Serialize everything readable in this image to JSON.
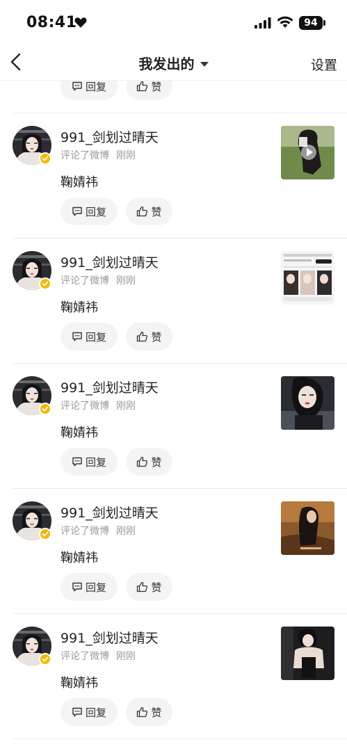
{
  "status_bar": {
    "time": "08:41",
    "battery": "94"
  },
  "nav": {
    "title": "我发出的",
    "settings": "设置"
  },
  "items": [
    {
      "username": "991_剑划过晴天",
      "action": "评论了微博",
      "time": "刚刚",
      "comment": "鞠婧祎",
      "reply_label": "回复",
      "like_label": "赞",
      "thumb_icon": "collage-thumbnail"
    },
    {
      "username": "991_剑划过晴天",
      "action": "评论了微博",
      "time": "刚刚",
      "comment": "鞠婧祎",
      "reply_label": "回复",
      "like_label": "赞",
      "thumb_icon": "video-thumbnail"
    },
    {
      "username": "991_剑划过晴天",
      "action": "评论了微博",
      "time": "刚刚",
      "comment": "鞠婧祎",
      "reply_label": "回复",
      "like_label": "赞",
      "thumb_icon": "screenshot-thumbnail"
    },
    {
      "username": "991_剑划过晴天",
      "action": "评论了微博",
      "time": "刚刚",
      "comment": "鞠婧祎",
      "reply_label": "回复",
      "like_label": "赞",
      "thumb_icon": "portrait-thumbnail"
    },
    {
      "username": "991_剑划过晴天",
      "action": "评论了微博",
      "time": "刚刚",
      "comment": "鞠婧祎",
      "reply_label": "回复",
      "like_label": "赞",
      "thumb_icon": "photo-thumbnail"
    },
    {
      "username": "991_剑划过晴天",
      "action": "评论了微博",
      "time": "刚刚",
      "comment": "鞠婧祎",
      "reply_label": "回复",
      "like_label": "赞",
      "thumb_icon": "fashion-thumbnail"
    }
  ],
  "colors": {
    "verified_badge": "#f5b800",
    "meta_text": "#9a9a9a",
    "button_bg": "#f4f4f4"
  }
}
